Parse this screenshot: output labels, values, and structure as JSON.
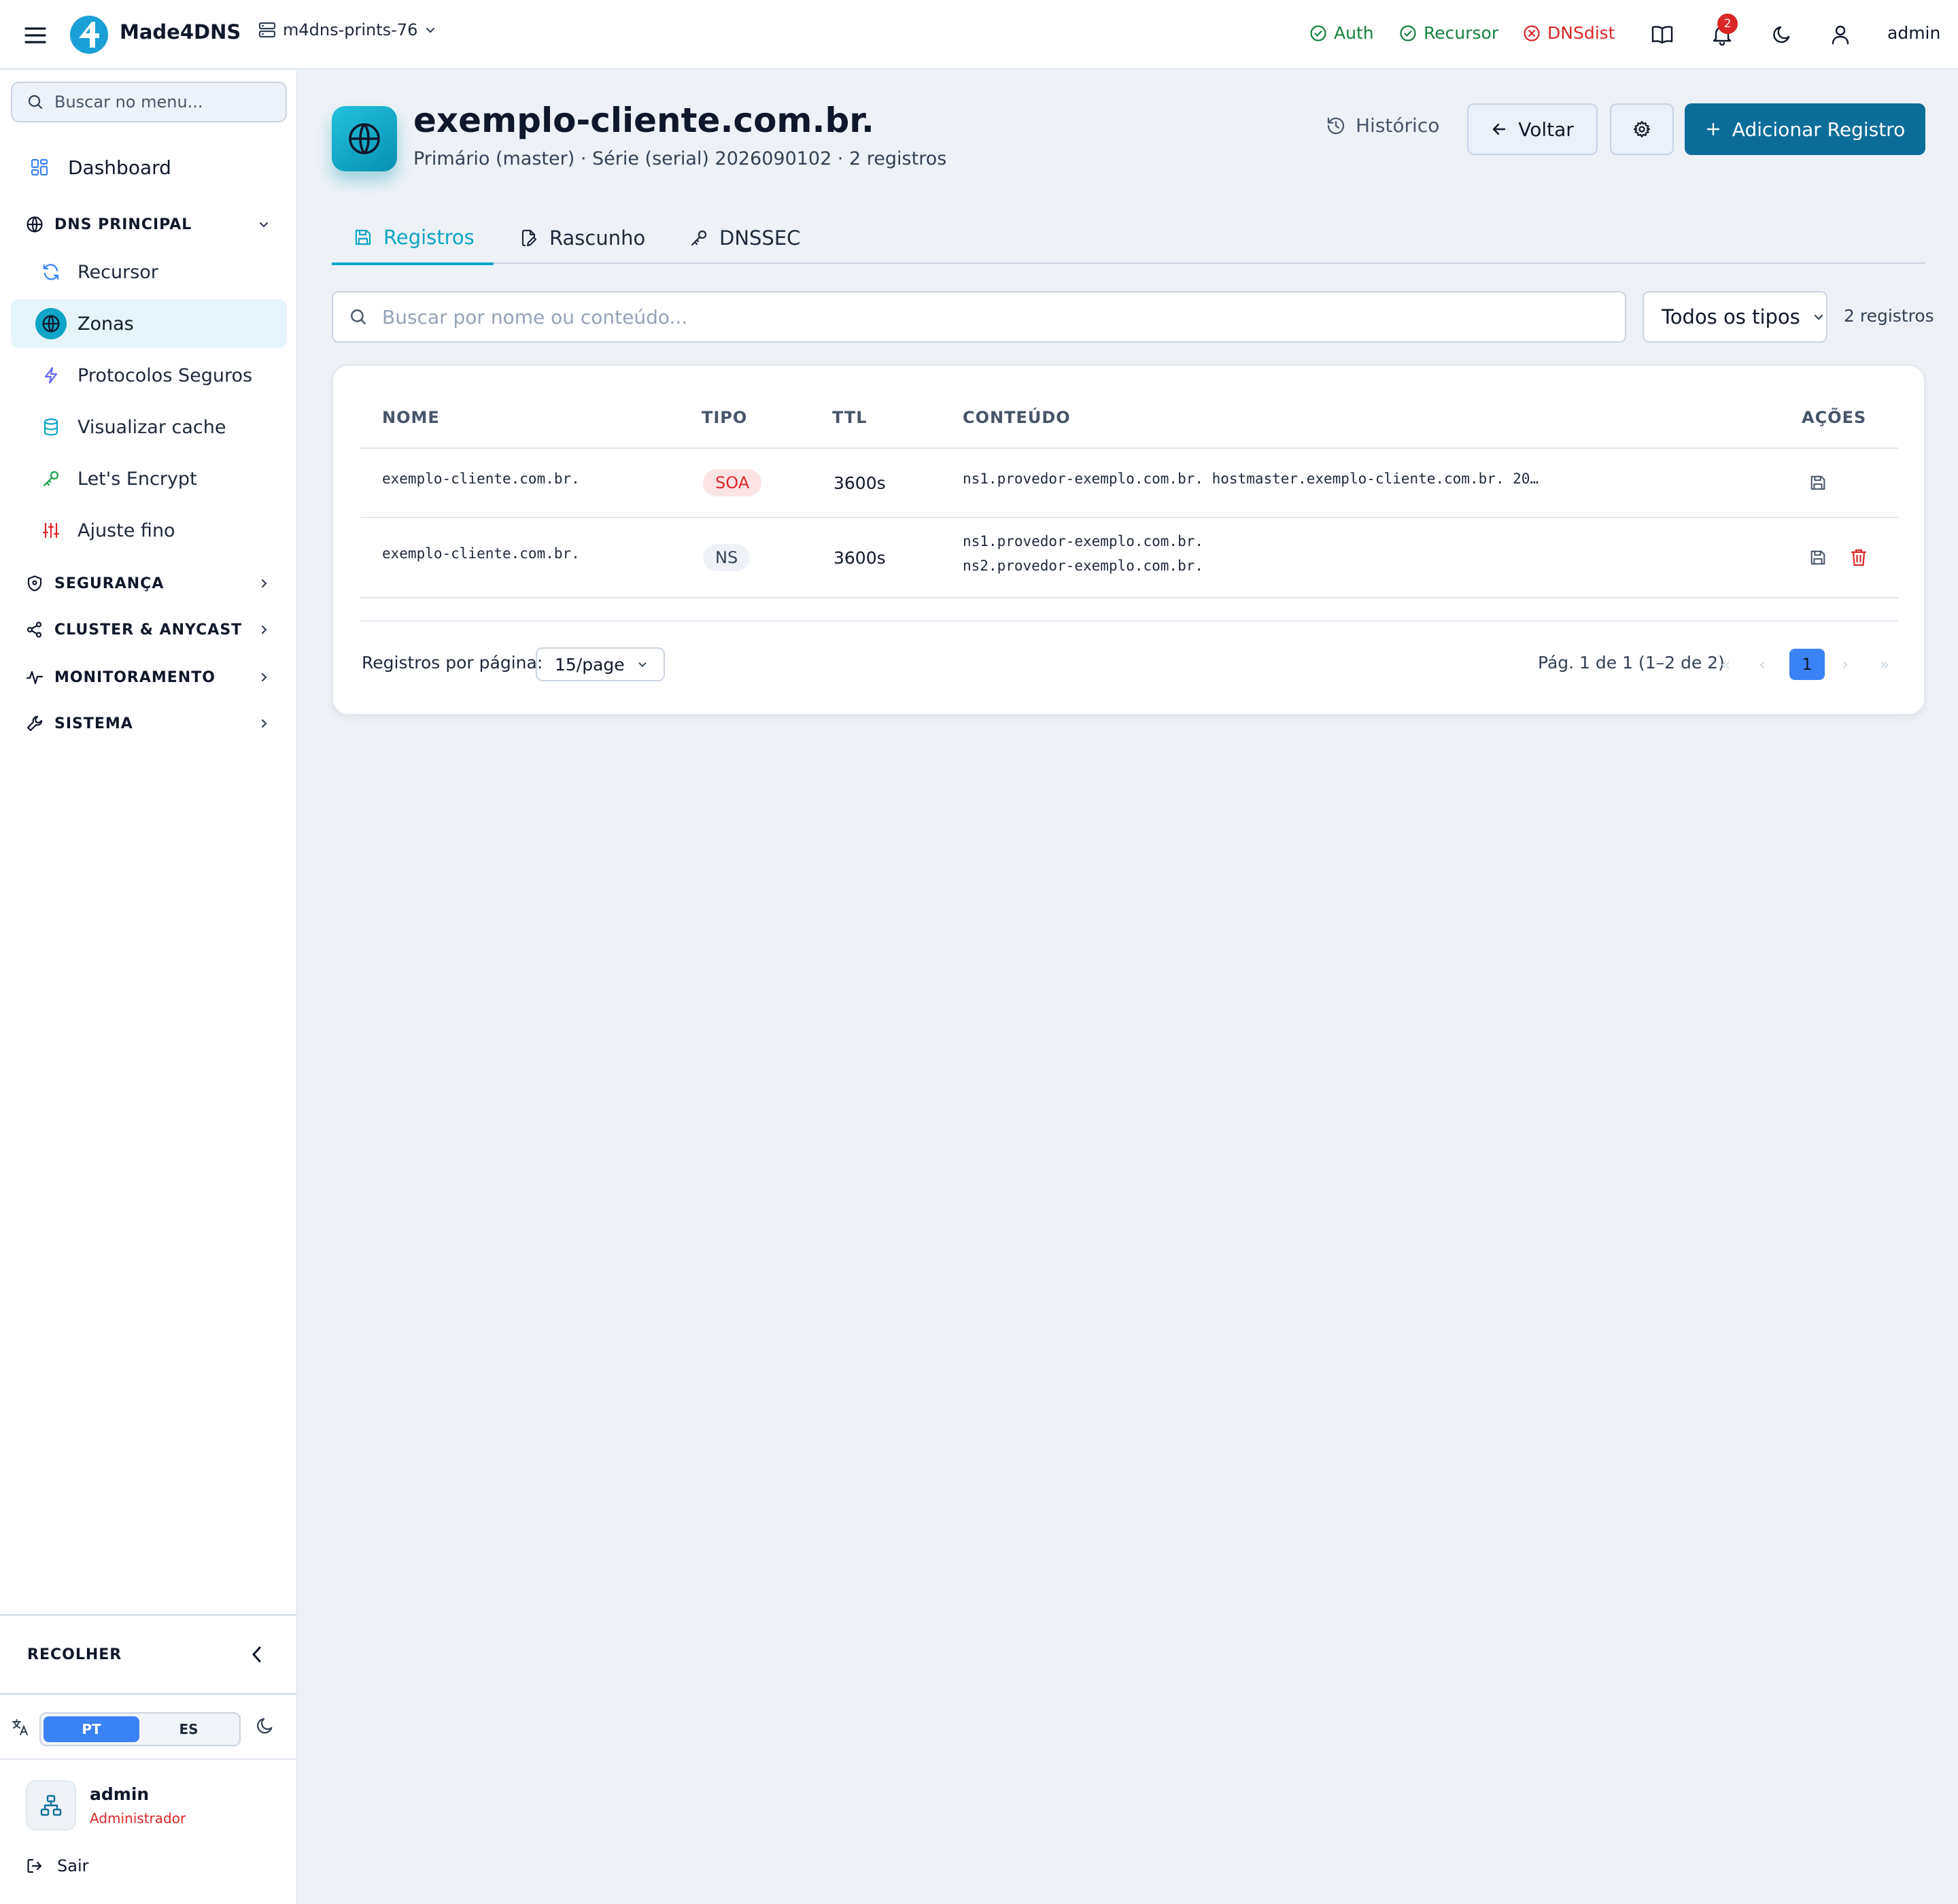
{
  "topbar": {
    "brand": "Made4DNS",
    "server": "m4dns-prints-76",
    "services": [
      {
        "label": "Auth",
        "state": "ok"
      },
      {
        "label": "Recursor",
        "state": "ok"
      },
      {
        "label": "DNSdist",
        "state": "error"
      }
    ],
    "notifications_count": "2",
    "user": "admin",
    "colors": {
      "ok": "#15803d",
      "error": "#dc2626",
      "brand": "#1aa0d6"
    }
  },
  "sidebar": {
    "search_placeholder": "Buscar no menu...",
    "dashboard": "Dashboard",
    "sections": {
      "dns_principal": "DNS PRINCIPAL",
      "seguranca": "SEGURANÇA",
      "cluster": "CLUSTER & ANYCAST",
      "monitoramento": "MONITORAMENTO",
      "sistema": "SISTEMA"
    },
    "items": [
      {
        "label": "Recursor",
        "icon": "refresh-icon"
      },
      {
        "label": "Zonas",
        "icon": "globe-icon",
        "active": true
      },
      {
        "label": "Protocolos Seguros",
        "icon": "bolt-icon"
      },
      {
        "label": "Visualizar cache",
        "icon": "database-icon"
      },
      {
        "label": "Let's Encrypt",
        "icon": "key-icon"
      },
      {
        "label": "Ajuste fino",
        "icon": "sliders-icon"
      }
    ],
    "collapse": "RECOLHER",
    "languages": [
      "PT",
      "ES"
    ],
    "active_language": "PT",
    "profile": {
      "name": "admin",
      "role": "Administrador"
    },
    "logout": "Sair"
  },
  "zone": {
    "title": "exemplo-cliente.com.br.",
    "subtitle": "Primário (master) · Série (serial) 2026090102 · 2 registros"
  },
  "actions": {
    "history": "Histórico",
    "back": "Voltar",
    "add": "Adicionar Registro",
    "accent": "#0b6e99"
  },
  "tabs": [
    {
      "label": "Registros",
      "active": true
    },
    {
      "label": "Rascunho"
    },
    {
      "label": "DNSSEC"
    }
  ],
  "filters": {
    "search_placeholder": "Buscar por nome ou conteúdo...",
    "type_filter": "Todos os tipos",
    "count": "2 registros"
  },
  "table": {
    "columns": [
      "NOME",
      "TIPO",
      "TTL",
      "CONTEÚDO",
      "AÇÕES"
    ],
    "rows": [
      {
        "name": "exemplo-cliente.com.br.",
        "type": "SOA",
        "ttl": "3600s",
        "content": [
          "ns1.provedor-exemplo.com.br. hostmaster.exemplo-cliente.com.br. 20…"
        ]
      },
      {
        "name": "exemplo-cliente.com.br.",
        "type": "NS",
        "ttl": "3600s",
        "content": [
          "ns1.provedor-exemplo.com.br.",
          "ns2.provedor-exemplo.com.br."
        ]
      }
    ]
  },
  "pagination": {
    "per_page_label": "Registros por página:",
    "per_page": "15/page",
    "info": "Pág. 1 de 1 (1–2 de 2)",
    "first": "«",
    "prev": "‹",
    "current": "1",
    "next": "›",
    "last": "»"
  }
}
